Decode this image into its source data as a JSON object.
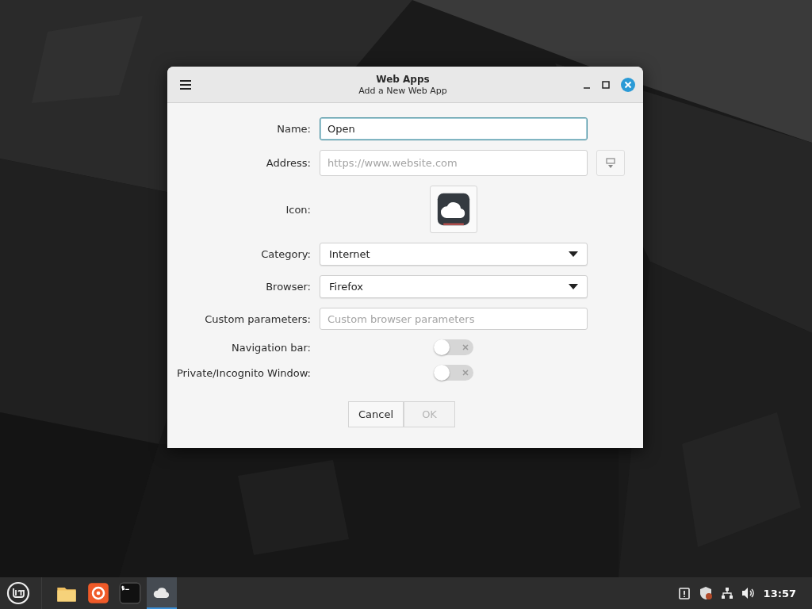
{
  "window": {
    "title": "Web Apps",
    "subtitle": "Add a New Web App"
  },
  "form": {
    "name": {
      "label": "Name:",
      "value": "Open "
    },
    "address": {
      "label": "Address:",
      "placeholder": "https://www.website.com"
    },
    "icon": {
      "label": "Icon:"
    },
    "category": {
      "label": "Category:",
      "value": "Internet"
    },
    "browser": {
      "label": "Browser:",
      "value": "Firefox"
    },
    "custom_parameters": {
      "label": "Custom parameters:",
      "placeholder": "Custom browser parameters"
    },
    "toggles": [
      {
        "label": "Navigation bar:",
        "on": false
      },
      {
        "label": "Private/Incognito Window:",
        "on": false
      }
    ],
    "buttons": [
      {
        "label": "Cancel",
        "disabled": false
      },
      {
        "label": "OK",
        "disabled": true
      }
    ]
  },
  "taskbar": {
    "apps": [
      {
        "kind": "files",
        "active": false
      },
      {
        "kind": "firefox",
        "active": false
      },
      {
        "kind": "terminal",
        "active": false
      },
      {
        "kind": "webapps",
        "active": true
      }
    ],
    "clock": "13:57"
  }
}
